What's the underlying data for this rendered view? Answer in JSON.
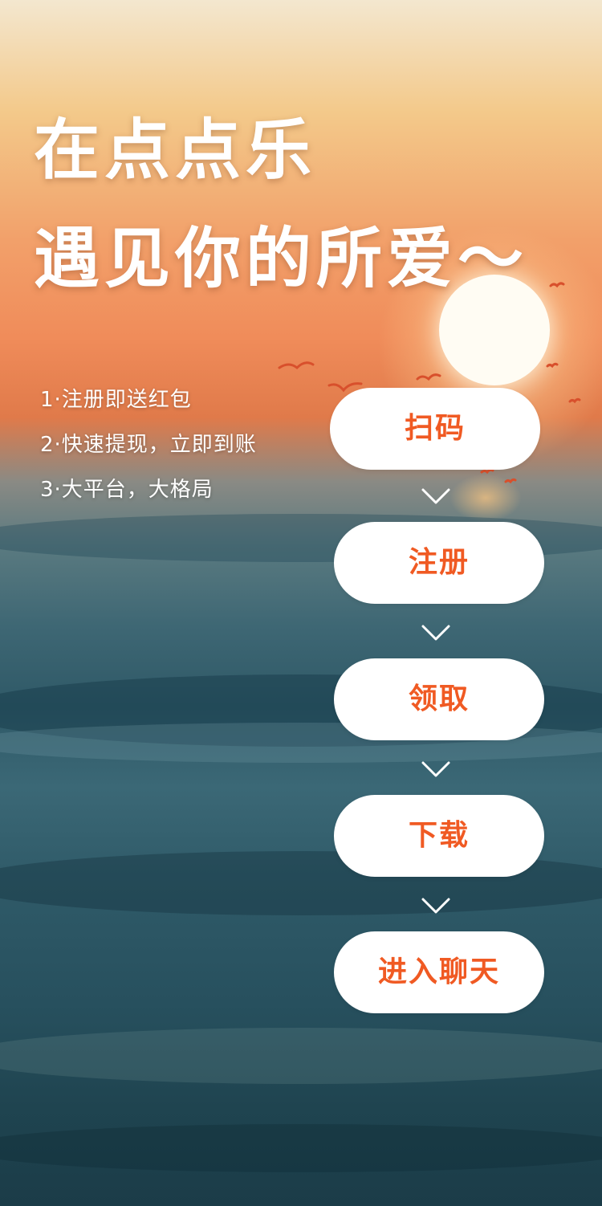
{
  "headline": {
    "line1": "在点点乐",
    "line2": "遇见你的所爱～"
  },
  "features": [
    "1·注册即送红包",
    "2·快速提现，立即到账",
    "3·大平台，大格局"
  ],
  "steps": [
    {
      "label": "扫码"
    },
    {
      "label": "注册"
    },
    {
      "label": "领取"
    },
    {
      "label": "下载"
    },
    {
      "label": "进入聊天"
    }
  ],
  "colors": {
    "accent": "#f05a23",
    "button_bg": "#ffffff",
    "text": "#ffffff"
  },
  "icons": {
    "arrow": "chevron-down-icon"
  }
}
